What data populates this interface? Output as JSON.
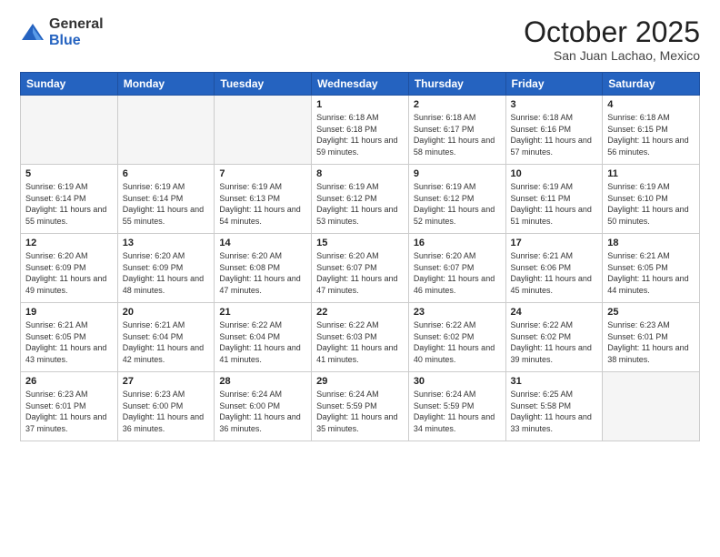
{
  "header": {
    "logo": {
      "general": "General",
      "blue": "Blue"
    },
    "title": "October 2025",
    "location": "San Juan Lachao, Mexico"
  },
  "weekdays": [
    "Sunday",
    "Monday",
    "Tuesday",
    "Wednesday",
    "Thursday",
    "Friday",
    "Saturday"
  ],
  "weeks": [
    [
      {
        "day": "",
        "sunrise": "",
        "sunset": "",
        "daylight": ""
      },
      {
        "day": "",
        "sunrise": "",
        "sunset": "",
        "daylight": ""
      },
      {
        "day": "",
        "sunrise": "",
        "sunset": "",
        "daylight": ""
      },
      {
        "day": "1",
        "sunrise": "6:18 AM",
        "sunset": "6:18 PM",
        "daylight": "11 hours and 59 minutes."
      },
      {
        "day": "2",
        "sunrise": "6:18 AM",
        "sunset": "6:17 PM",
        "daylight": "11 hours and 58 minutes."
      },
      {
        "day": "3",
        "sunrise": "6:18 AM",
        "sunset": "6:16 PM",
        "daylight": "11 hours and 57 minutes."
      },
      {
        "day": "4",
        "sunrise": "6:18 AM",
        "sunset": "6:15 PM",
        "daylight": "11 hours and 56 minutes."
      }
    ],
    [
      {
        "day": "5",
        "sunrise": "6:19 AM",
        "sunset": "6:14 PM",
        "daylight": "11 hours and 55 minutes."
      },
      {
        "day": "6",
        "sunrise": "6:19 AM",
        "sunset": "6:14 PM",
        "daylight": "11 hours and 55 minutes."
      },
      {
        "day": "7",
        "sunrise": "6:19 AM",
        "sunset": "6:13 PM",
        "daylight": "11 hours and 54 minutes."
      },
      {
        "day": "8",
        "sunrise": "6:19 AM",
        "sunset": "6:12 PM",
        "daylight": "11 hours and 53 minutes."
      },
      {
        "day": "9",
        "sunrise": "6:19 AM",
        "sunset": "6:12 PM",
        "daylight": "11 hours and 52 minutes."
      },
      {
        "day": "10",
        "sunrise": "6:19 AM",
        "sunset": "6:11 PM",
        "daylight": "11 hours and 51 minutes."
      },
      {
        "day": "11",
        "sunrise": "6:19 AM",
        "sunset": "6:10 PM",
        "daylight": "11 hours and 50 minutes."
      }
    ],
    [
      {
        "day": "12",
        "sunrise": "6:20 AM",
        "sunset": "6:09 PM",
        "daylight": "11 hours and 49 minutes."
      },
      {
        "day": "13",
        "sunrise": "6:20 AM",
        "sunset": "6:09 PM",
        "daylight": "11 hours and 48 minutes."
      },
      {
        "day": "14",
        "sunrise": "6:20 AM",
        "sunset": "6:08 PM",
        "daylight": "11 hours and 47 minutes."
      },
      {
        "day": "15",
        "sunrise": "6:20 AM",
        "sunset": "6:07 PM",
        "daylight": "11 hours and 47 minutes."
      },
      {
        "day": "16",
        "sunrise": "6:20 AM",
        "sunset": "6:07 PM",
        "daylight": "11 hours and 46 minutes."
      },
      {
        "day": "17",
        "sunrise": "6:21 AM",
        "sunset": "6:06 PM",
        "daylight": "11 hours and 45 minutes."
      },
      {
        "day": "18",
        "sunrise": "6:21 AM",
        "sunset": "6:05 PM",
        "daylight": "11 hours and 44 minutes."
      }
    ],
    [
      {
        "day": "19",
        "sunrise": "6:21 AM",
        "sunset": "6:05 PM",
        "daylight": "11 hours and 43 minutes."
      },
      {
        "day": "20",
        "sunrise": "6:21 AM",
        "sunset": "6:04 PM",
        "daylight": "11 hours and 42 minutes."
      },
      {
        "day": "21",
        "sunrise": "6:22 AM",
        "sunset": "6:04 PM",
        "daylight": "11 hours and 41 minutes."
      },
      {
        "day": "22",
        "sunrise": "6:22 AM",
        "sunset": "6:03 PM",
        "daylight": "11 hours and 41 minutes."
      },
      {
        "day": "23",
        "sunrise": "6:22 AM",
        "sunset": "6:02 PM",
        "daylight": "11 hours and 40 minutes."
      },
      {
        "day": "24",
        "sunrise": "6:22 AM",
        "sunset": "6:02 PM",
        "daylight": "11 hours and 39 minutes."
      },
      {
        "day": "25",
        "sunrise": "6:23 AM",
        "sunset": "6:01 PM",
        "daylight": "11 hours and 38 minutes."
      }
    ],
    [
      {
        "day": "26",
        "sunrise": "6:23 AM",
        "sunset": "6:01 PM",
        "daylight": "11 hours and 37 minutes."
      },
      {
        "day": "27",
        "sunrise": "6:23 AM",
        "sunset": "6:00 PM",
        "daylight": "11 hours and 36 minutes."
      },
      {
        "day": "28",
        "sunrise": "6:24 AM",
        "sunset": "6:00 PM",
        "daylight": "11 hours and 36 minutes."
      },
      {
        "day": "29",
        "sunrise": "6:24 AM",
        "sunset": "5:59 PM",
        "daylight": "11 hours and 35 minutes."
      },
      {
        "day": "30",
        "sunrise": "6:24 AM",
        "sunset": "5:59 PM",
        "daylight": "11 hours and 34 minutes."
      },
      {
        "day": "31",
        "sunrise": "6:25 AM",
        "sunset": "5:58 PM",
        "daylight": "11 hours and 33 minutes."
      },
      {
        "day": "",
        "sunrise": "",
        "sunset": "",
        "daylight": ""
      }
    ]
  ]
}
